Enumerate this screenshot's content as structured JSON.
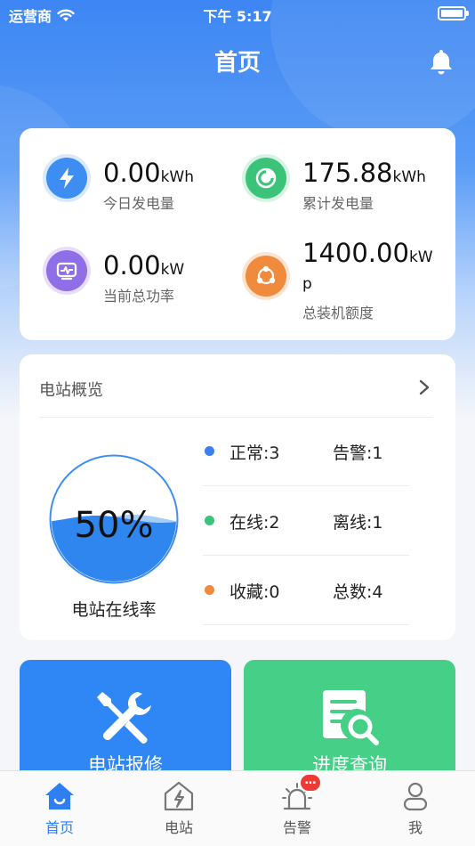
{
  "status_bar": {
    "carrier": "运营商",
    "time": "下午 5:17"
  },
  "header": {
    "title": "首页"
  },
  "stats": [
    {
      "value": "0.00",
      "unit": "kWh",
      "label": "今日发电量",
      "icon": "lightning-icon",
      "color": "#3d8df3"
    },
    {
      "value": "175.88",
      "unit": "kWh",
      "label": "累计发电量",
      "icon": "pie-chart-icon",
      "color": "#3cc37a"
    },
    {
      "value": "0.00",
      "unit": "kW",
      "label": "当前总功率",
      "icon": "monitor-wave-icon",
      "color": "#8f6ee8"
    },
    {
      "value": "1400.00",
      "unit": "kWp",
      "label": "总装机额度",
      "icon": "network-icon",
      "color": "#f08a3c"
    }
  ],
  "overview": {
    "title": "电站概览",
    "gauge_percent": 50,
    "gauge_text": "50%",
    "gauge_caption": "电站在线率",
    "rows": [
      {
        "left": "正常:3",
        "right": "告警:1",
        "color": "#3d7ff0"
      },
      {
        "left": "在线:2",
        "right": "离线:1",
        "color": "#3cc37a"
      },
      {
        "left": "收藏:0",
        "right": "总数:4",
        "color": "#f08a3c"
      }
    ]
  },
  "tiles": [
    {
      "label": "电站报修",
      "color": "#2f86f5",
      "icon": "repair-tools-icon"
    },
    {
      "label": "进度查询",
      "color": "#46cf86",
      "icon": "document-search-icon"
    }
  ],
  "tabbar": {
    "items": [
      {
        "label": "首页",
        "icon": "home-icon",
        "active": true
      },
      {
        "label": "电站",
        "icon": "station-icon",
        "active": false
      },
      {
        "label": "告警",
        "icon": "alarm-icon",
        "active": false
      },
      {
        "label": "我",
        "icon": "user-icon",
        "active": false
      }
    ],
    "alarm_badge": "…"
  },
  "colors": {
    "accent": "#2f7ef2",
    "background": "#f4f6f9"
  }
}
